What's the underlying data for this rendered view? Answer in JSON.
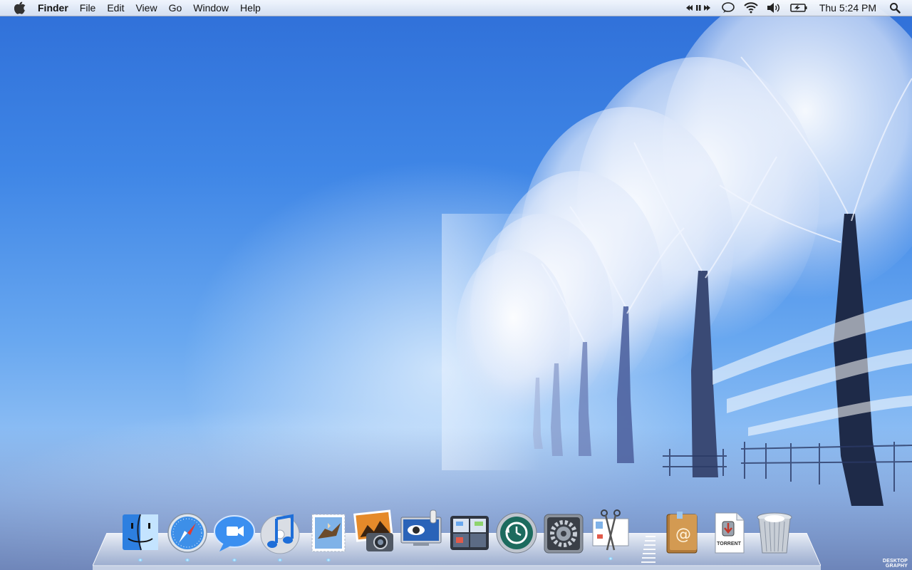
{
  "menubar": {
    "apple_icon": "apple-logo-icon",
    "app_name": "Finder",
    "menus": [
      "File",
      "Edit",
      "View",
      "Go",
      "Window",
      "Help"
    ],
    "status_icons": [
      "media-controls-icon",
      "ichat-status-icon",
      "wifi-icon",
      "volume-icon",
      "battery-icon"
    ],
    "clock": "Thu 5:24 PM",
    "spotlight_icon": "spotlight-search-icon"
  },
  "dock": {
    "items": [
      {
        "name": "finder",
        "icon": "finder-icon",
        "running": true
      },
      {
        "name": "safari",
        "icon": "safari-icon",
        "running": true
      },
      {
        "name": "ichat",
        "icon": "ichat-icon",
        "running": true
      },
      {
        "name": "itunes",
        "icon": "itunes-icon",
        "running": true
      },
      {
        "name": "mail",
        "icon": "mail-icon",
        "running": true
      },
      {
        "name": "iphoto",
        "icon": "iphoto-icon",
        "running": false
      },
      {
        "name": "front-row",
        "icon": "front-row-icon",
        "running": false
      },
      {
        "name": "spaces",
        "icon": "spaces-icon",
        "running": false
      },
      {
        "name": "time-machine",
        "icon": "time-machine-icon",
        "running": false
      },
      {
        "name": "system-preferences",
        "icon": "system-preferences-icon",
        "running": false
      },
      {
        "name": "screenshot-tool",
        "icon": "scissors-icon",
        "running": true
      },
      {
        "name": "address-book",
        "icon": "address-book-icon",
        "running": false
      },
      {
        "name": "torrent-document",
        "icon": "torrent-document-icon",
        "running": false,
        "label": "TORRENT"
      },
      {
        "name": "trash",
        "icon": "trash-icon",
        "running": false
      }
    ]
  },
  "wallpaper": {
    "description_colors": [
      "#2f6fd8",
      "#69a8f0",
      "#c9def5"
    ],
    "watermark_lines": [
      "DESKTOP",
      "GRAPHY"
    ]
  }
}
